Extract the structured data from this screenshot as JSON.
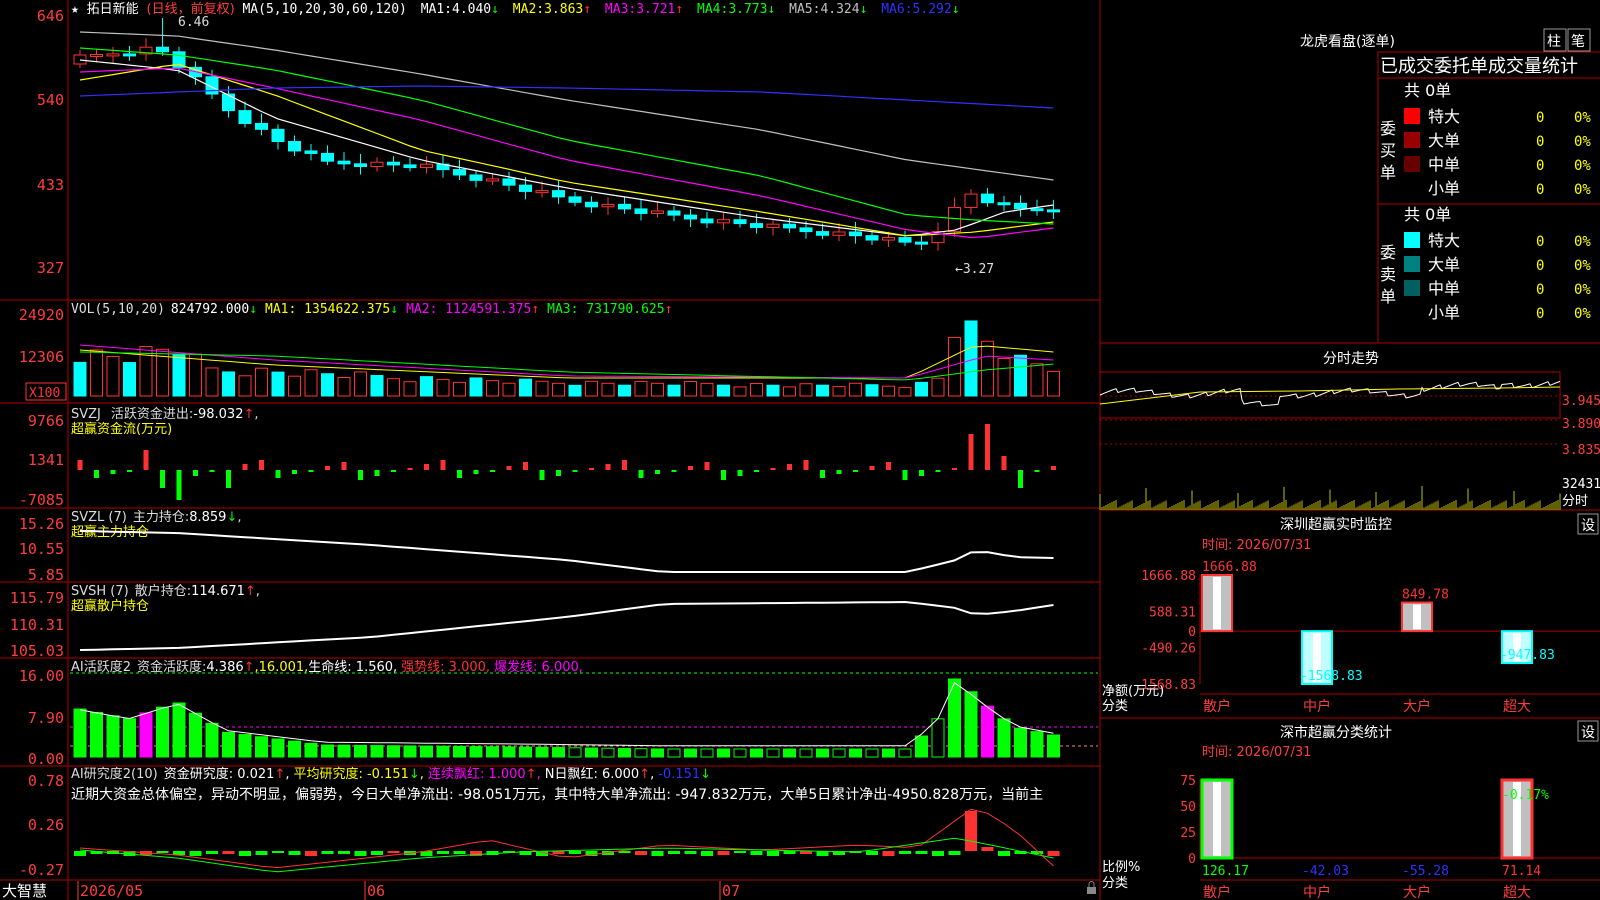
{
  "colors": {
    "up": "#ff3232",
    "down": "#00ffff",
    "white": "#ffffff",
    "yellow": "#ffff00",
    "magenta": "#ff00ff",
    "green": "#00ff00",
    "gray": "#c0c0c0",
    "blue": "#3030ff",
    "grid": "#b00000",
    "label": "#ff3c3c"
  },
  "header": {
    "star": "★",
    "name": "拓日新能",
    "period": "(日线，前复权)",
    "ma_prefix": "MA(5,10,20,30,60,120)",
    "ma": [
      {
        "label": "MA1:",
        "value": "4.040",
        "arrow": "↓",
        "color": "#ffffff"
      },
      {
        "label": "MA2:",
        "value": "3.863",
        "arrow": "↑",
        "color": "#ffff00"
      },
      {
        "label": "MA3:",
        "value": "3.721",
        "arrow": "↑",
        "color": "#ff00ff"
      },
      {
        "label": "MA4:",
        "value": "3.773",
        "arrow": "↓",
        "color": "#00ff00"
      },
      {
        "label": "MA5:",
        "value": "4.324",
        "arrow": "↓",
        "color": "#c0c0c0"
      },
      {
        "label": "MA6:",
        "value": "5.292",
        "arrow": "↓",
        "color": "#3030ff"
      }
    ],
    "high_label": "6.46",
    "low_label": "←3.27"
  },
  "price_axis": [
    "646",
    "540",
    "433",
    "327"
  ],
  "vol": {
    "title": "VOL(5,10,20)",
    "value": "824792.000",
    "ma1": "MA1: 1354622.375",
    "ma2": "MA2: 1124591.375",
    "ma3": "MA3: 731790.625",
    "axis": [
      "24920",
      "12306"
    ],
    "unit": "X100"
  },
  "svzj": {
    "title": "SVZJ",
    "label": "活跃资金进出:",
    "value": "-98.032",
    "sub": "超赢资金流(万元)",
    "axis": [
      "9766",
      "1341",
      "-7085"
    ]
  },
  "svzl": {
    "title": "SVZL (7)",
    "label": "主力持仓:",
    "value": "8.859",
    "sub": "超赢主力持仓",
    "axis": [
      "15.26",
      "10.55",
      "5.85"
    ]
  },
  "svsh": {
    "title": "SVSH (7)",
    "label": "散户持仓:",
    "value": "114.671",
    "sub": "超赢散户持仓",
    "axis": [
      "115.79",
      "110.31",
      "105.03"
    ]
  },
  "ai1": {
    "title": "AI活跃度2",
    "label": "资金活跃度:",
    "value": "4.386",
    "v2": "16.001",
    "life": "生命线: 1.560",
    "strong": "强势线: 3.000",
    "burst": "爆发线: 6.000",
    "axis": [
      "16.00",
      "7.90",
      "0.00"
    ]
  },
  "ai2": {
    "title": "AI研究度2(10)",
    "r1": "资金研究度: 0.021",
    "r2": "平均研究度: -0.151",
    "r3": "连续飘红: 1.000",
    "r4": "N日飘红: 6.000",
    "r5": "-0.151",
    "axis": [
      "0.78",
      "0.26",
      "-0.27"
    ],
    "comment": "近期大资金总体偏空，异动不明显，偏弱势，今日大单净流出: -98.051万元，其中特大单净流出: -947.832万元，大单5日累计净出-4950.828万元，当前主"
  },
  "bottom": {
    "brand": "大智慧",
    "dates": [
      "2026/05",
      "06",
      "07"
    ]
  },
  "right": {
    "title": "龙虎看盘(逐单)",
    "btn1": "柱",
    "btn2": "笔",
    "table_title": "已成交委托单成交量统计",
    "buy_label": "委买单",
    "sell_label": "委卖单",
    "buy_total": "共 0单",
    "sell_total": "共 0单",
    "buy_rows": [
      {
        "name": "特大",
        "count": "0",
        "pct": "0%",
        "color": "#ff0000"
      },
      {
        "name": "大单",
        "count": "0",
        "pct": "0%",
        "color": "#990000"
      },
      {
        "name": "中单",
        "count": "0",
        "pct": "0%",
        "color": "#660000"
      },
      {
        "name": "小单",
        "count": "0",
        "pct": "0%",
        "color": ""
      }
    ],
    "sell_rows": [
      {
        "name": "特大",
        "count": "0",
        "pct": "0%",
        "color": "#00ffff"
      },
      {
        "name": "大单",
        "count": "0",
        "pct": "0%",
        "color": "#008080"
      },
      {
        "name": "中单",
        "count": "0",
        "pct": "0%",
        "color": "#006060"
      },
      {
        "name": "小单",
        "count": "0",
        "pct": "0%",
        "color": ""
      }
    ],
    "fenshi": {
      "title": "分时走势",
      "axis": [
        "3.945",
        "3.890",
        "3.835"
      ],
      "vol": "32431",
      "vol_unit": "分时"
    },
    "monitor": {
      "title": "深圳超赢实时监控",
      "btn": "设",
      "time": "时间: 2026/07/31",
      "axis": [
        "1666.88",
        "588.31",
        "0",
        "-490.26",
        "-1568.83"
      ],
      "axis_label": "净额(万元)",
      "axis_label2": "分类",
      "cats": [
        "散户",
        "中户",
        "大户",
        "超大"
      ],
      "chart_data": {
        "type": "bar",
        "title": "深圳超赢实时监控",
        "categories": [
          "散户",
          "中户",
          "大户",
          "超大"
        ],
        "values": [
          1666.88,
          -1568.83,
          849.78,
          -947.83
        ],
        "ylim": [
          -1568.83,
          1666.88
        ]
      }
    },
    "stats": {
      "title": "深市超赢分类统计",
      "btn": "设",
      "time": "时间: 2026/07/31",
      "axis": [
        "75",
        "50",
        "25",
        "0"
      ],
      "axis_label": "比例%",
      "axis_label2": "分类",
      "cats": [
        "散户",
        "中户",
        "大户",
        "超大"
      ],
      "top_label": "-0.17%",
      "chart_data": {
        "type": "bar",
        "title": "深市超赢分类统计",
        "categories": [
          "散户",
          "中户",
          "大户",
          "超大"
        ],
        "values": [
          126.17,
          -42.03,
          -55.28,
          71.14
        ],
        "ylim": [
          0,
          75
        ]
      }
    }
  }
}
